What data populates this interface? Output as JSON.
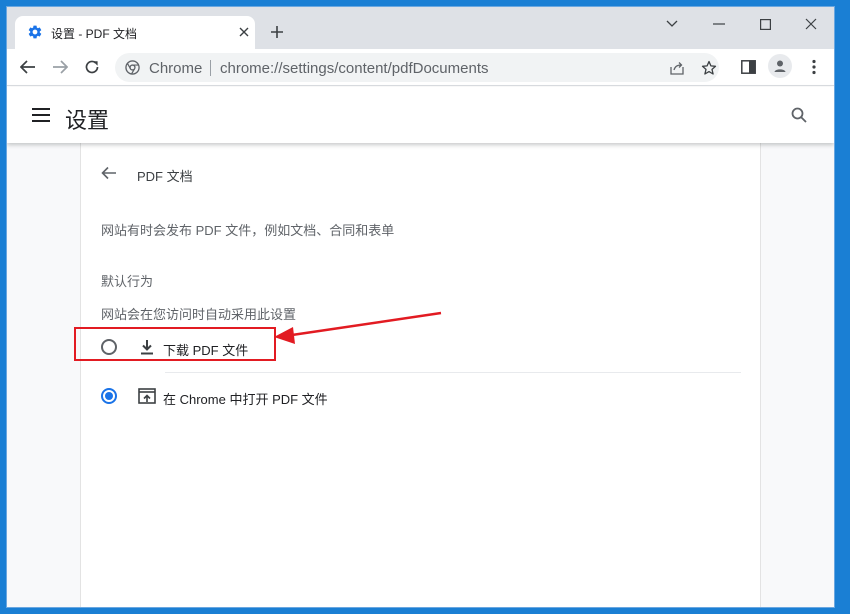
{
  "browser": {
    "tab": {
      "title": "设置 - PDF 文档"
    },
    "omnibox": {
      "chip": "Chrome",
      "url_host": "chrome://",
      "url_path": "settings/content/pdfDocuments"
    }
  },
  "settings": {
    "title": "设置",
    "page_title": "PDF 文档",
    "description": "网站有时会发布 PDF 文件，例如文档、合同和表单",
    "default_behavior": {
      "heading": "默认行为",
      "subheading": "网站会在您访问时自动采用此设置"
    },
    "options": [
      {
        "label": "下载 PDF 文件",
        "checked": false,
        "icon": "download-icon"
      },
      {
        "label": "在 Chrome 中打开 PDF 文件",
        "checked": true,
        "icon": "open-in-browser-icon"
      }
    ]
  },
  "colors": {
    "accent": "#1a73e8",
    "annotation": "#e21b22",
    "desktop": "#1a7fd4"
  }
}
